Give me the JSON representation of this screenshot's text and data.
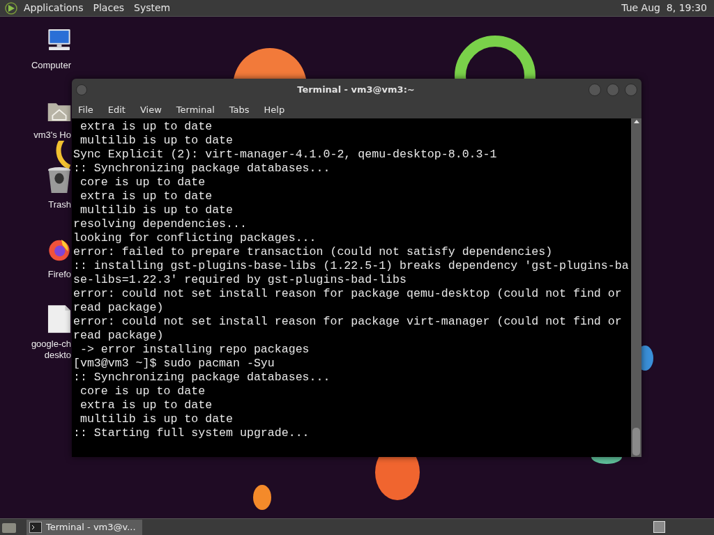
{
  "top_panel": {
    "menus": [
      "Applications",
      "Places",
      "System"
    ],
    "clock": "Tue Aug  8, 19:30"
  },
  "desktop_icons": [
    {
      "kind": "computer",
      "label": "Computer"
    },
    {
      "kind": "home",
      "label": "vm3's Ho"
    },
    {
      "kind": "trash",
      "label": "Trash"
    },
    {
      "kind": "browser",
      "label": "Firefo"
    },
    {
      "kind": "file",
      "label": "google-ch\ndeskto"
    }
  ],
  "window": {
    "title": "Terminal - vm3@vm3:~",
    "menu": [
      "File",
      "Edit",
      "View",
      "Terminal",
      "Tabs",
      "Help"
    ],
    "lines": [
      " extra is up to date",
      " multilib is up to date",
      "Sync Explicit (2): virt-manager-4.1.0-2, qemu-desktop-8.0.3-1",
      ":: Synchronizing package databases...",
      " core is up to date",
      " extra is up to date",
      " multilib is up to date",
      "resolving dependencies...",
      "looking for conflicting packages...",
      "error: failed to prepare transaction (could not satisfy dependencies)",
      ":: installing gst-plugins-base-libs (1.22.5-1) breaks dependency 'gst-plugins-ba",
      "se-libs=1.22.3' required by gst-plugins-bad-libs",
      "error: could not set install reason for package qemu-desktop (could not find or",
      "read package)",
      "error: could not set install reason for package virt-manager (could not find or",
      "read package)",
      " -> error installing repo packages",
      "[vm3@vm3 ~]$ sudo pacman -Syu",
      ":: Synchronizing package databases...",
      " core is up to date",
      " extra is up to date",
      " multilib is up to date",
      ":: Starting full system upgrade..."
    ]
  },
  "taskbar": {
    "tasks": [
      {
        "label": "Terminal - vm3@v...",
        "selected": true
      }
    ]
  }
}
